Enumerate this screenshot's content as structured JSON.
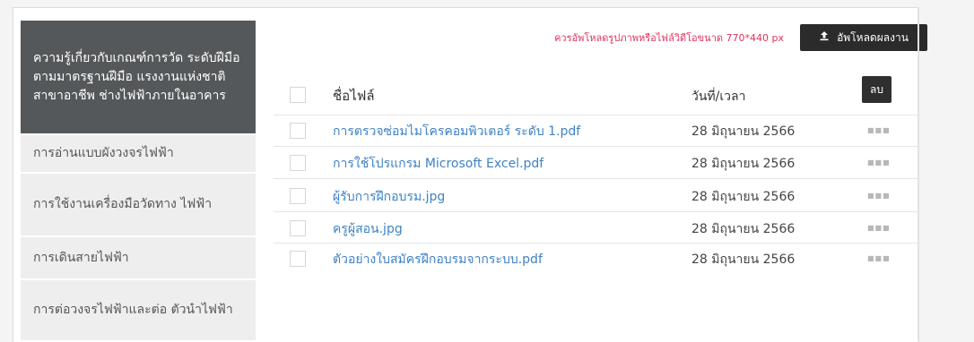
{
  "sidebar": {
    "items": [
      {
        "label": "ความรู้เกี่ยวกับเกณฑ์การวัด ระดับฝีมือตามมาตรฐานฝีมือ แรงงานแห่งชาติ สาขาอาชีพ ช่างไฟฟ้าภายในอาคาร",
        "active": true
      },
      {
        "label": "การอ่านแบบผังวงจรไฟฟ้า",
        "active": false
      },
      {
        "label": "การใช้งานเครื่องมือวัดทาง ไฟฟ้า",
        "active": false
      },
      {
        "label": "การเดินสายไฟฟ้า",
        "active": false
      },
      {
        "label": "การต่อวงจรไฟฟ้าและต่อ ตัวนำไฟฟ้า",
        "active": false
      }
    ]
  },
  "upload": {
    "hint": "ควรอัพโหลดรูปภาพหรือไฟล์วิดีโอขนาด 770*440 px",
    "button_label": "อัพโหลดผลงาน",
    "icon": "upload-icon"
  },
  "table": {
    "columns": {
      "name": "ชื่อไฟล์",
      "date": "วันที่/เวลา"
    },
    "delete_label": "ลบ",
    "rows": [
      {
        "name": "การตรวจซ่อมไมโครคอมพิวเตอร์ ระดับ 1.pdf",
        "date": "28 มิถุนายน 2566"
      },
      {
        "name": "การใช้โปรแกรม Microsoft Excel.pdf",
        "date": "28 มิถุนายน 2566"
      },
      {
        "name": "ผู้รับการฝึกอบรม.jpg",
        "date": "28 มิถุนายน 2566"
      },
      {
        "name": "ครูผู้สอน.jpg",
        "date": "28 มิถุนายน 2566"
      },
      {
        "name": "ตัวอย่างใบสมัครฝึกอบรมจากระบบ.pdf",
        "date": "28 มิถุนายน 2566"
      }
    ]
  },
  "colors": {
    "accent_link": "#3f82c4",
    "hint_red": "#e0335e",
    "dark_button": "#2b2b2b",
    "sidebar_active": "#55585a"
  }
}
